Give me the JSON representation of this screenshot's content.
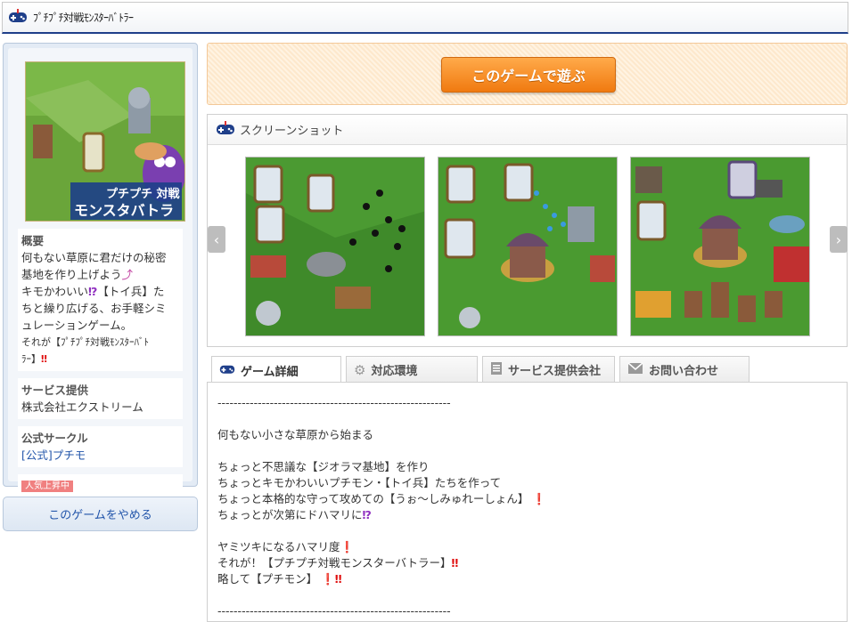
{
  "header": {
    "title": "ﾌﾟﾁﾌﾟﾁ対戦ﾓﾝｽﾀｰﾊﾞﾄﾗｰ",
    "icon": "gamepad-icon"
  },
  "sidebar": {
    "cover_caption": "プチプチ 対戦 モンスターバトラ",
    "overview": {
      "title": "概要",
      "lines": [
        "何もない草原に君だけの秘密",
        "基地を作り上げよう",
        "キモかわいい",
        "【トイ兵】た",
        "ちと繰り広げる、お手軽シミ",
        "ュレーションゲーム。",
        "それが【ﾌﾟﾁﾌﾟﾁ対戦ﾓﾝｽﾀｰﾊﾞﾄ",
        "ﾗｰ】"
      ]
    },
    "provider": {
      "title": "サービス提供",
      "value": "株式会社エクストリーム"
    },
    "circle": {
      "title": "公式サークル",
      "link": "[公式]プチモ"
    },
    "badge": "人気上昇中",
    "quit_label": "このゲームをやめる"
  },
  "play_label": "このゲームで遊ぶ",
  "screenshots": {
    "title": "スクリーンショット"
  },
  "tabs": [
    {
      "label": "ゲーム詳細",
      "icon": "gamepad-icon"
    },
    {
      "label": "対応環境",
      "icon": "gear-icon"
    },
    {
      "label": "サービス提供会社",
      "icon": "document-icon"
    },
    {
      "label": "お問い合わせ",
      "icon": "mail-icon"
    }
  ],
  "details": {
    "lines": [
      "----------------------------------------------------------",
      "",
      "何もない小さな草原から始まる",
      "",
      "ちょっと不思議な【ジオラマ基地】を作り",
      "ちょっとキモかわいいプチモン・【トイ兵】たちを作って",
      "ちょっと本格的な守って攻めての【うぉ～しみゅれーしょん】",
      "ちょっとが次第にドハマリに",
      "",
      "ヤミツキになるハマリ度",
      "それが！【プチプチ対戦モンスターバトラー】",
      "略して【プチモン】",
      "",
      "----------------------------------------------------------"
    ]
  },
  "colors": {
    "accent": "#1f3f8a",
    "play": "#f07a10",
    "link": "#2255aa"
  }
}
